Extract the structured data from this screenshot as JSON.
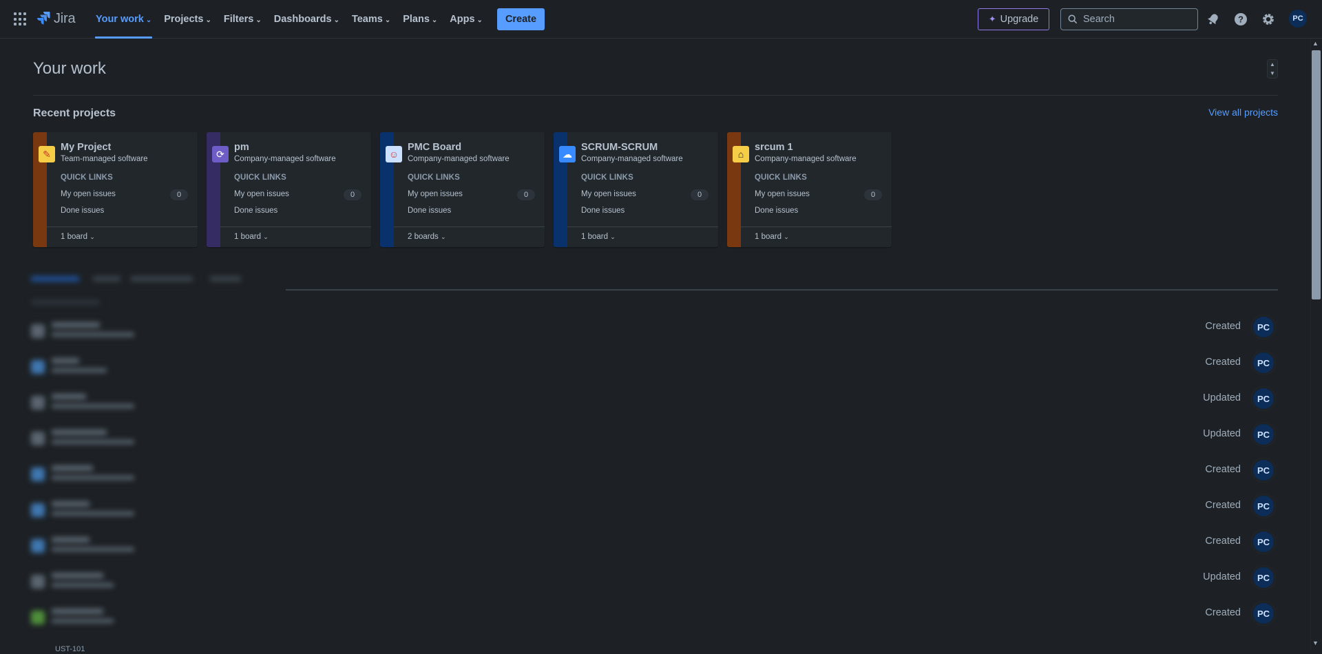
{
  "app": {
    "name": "Jira"
  },
  "nav": {
    "items": [
      {
        "label": "Your work",
        "active": true
      },
      {
        "label": "Projects"
      },
      {
        "label": "Filters"
      },
      {
        "label": "Dashboards"
      },
      {
        "label": "Teams"
      },
      {
        "label": "Plans"
      },
      {
        "label": "Apps"
      }
    ],
    "create_label": "Create",
    "upgrade_label": "Upgrade",
    "search_placeholder": "Search",
    "user_initials": "PC"
  },
  "page": {
    "title": "Your work",
    "recent_title": "Recent projects",
    "view_all": "View all projects"
  },
  "projects": [
    {
      "name": "My Project",
      "type": "Team-managed software",
      "quick_links": "QUICK LINKS",
      "open_label": "My open issues",
      "open_count": "0",
      "done_label": "Done issues",
      "boards": "1 board",
      "stripe": "#7a3810",
      "icon": "pencil-icon"
    },
    {
      "name": "pm",
      "type": "Company-managed software",
      "quick_links": "QUICK LINKS",
      "open_label": "My open issues",
      "open_count": "0",
      "done_label": "Done issues",
      "boards": "1 board",
      "stripe": "#352c63",
      "icon": "refresh-icon"
    },
    {
      "name": "PMC Board",
      "type": "Company-managed software",
      "quick_links": "QUICK LINKS",
      "open_label": "My open issues",
      "open_count": "0",
      "done_label": "Done issues",
      "boards": "2 boards",
      "stripe": "#09326c",
      "icon": "astronaut-icon"
    },
    {
      "name": "SCRUM-SCRUM",
      "type": "Company-managed software",
      "quick_links": "QUICK LINKS",
      "open_label": "My open issues",
      "open_count": "0",
      "done_label": "Done issues",
      "boards": "1 board",
      "stripe": "#09326c",
      "icon": "cloud-icon"
    },
    {
      "name": "srcum 1",
      "type": "Company-managed software",
      "quick_links": "QUICK LINKS",
      "open_label": "My open issues",
      "open_count": "0",
      "done_label": "Done issues",
      "boards": "1 board",
      "stripe": "#7a3810",
      "icon": "bus-icon"
    }
  ],
  "activity": [
    {
      "status": "Created",
      "initials": "PC"
    },
    {
      "status": "Created",
      "initials": "PC"
    },
    {
      "status": "Updated",
      "initials": "PC"
    },
    {
      "status": "Updated",
      "initials": "PC"
    },
    {
      "status": "Created",
      "initials": "PC"
    },
    {
      "status": "Created",
      "initials": "PC"
    },
    {
      "status": "Created",
      "initials": "PC"
    },
    {
      "status": "Updated",
      "initials": "PC"
    },
    {
      "status": "Created",
      "initials": "PC"
    }
  ],
  "activity_partial_key": "UST-101"
}
